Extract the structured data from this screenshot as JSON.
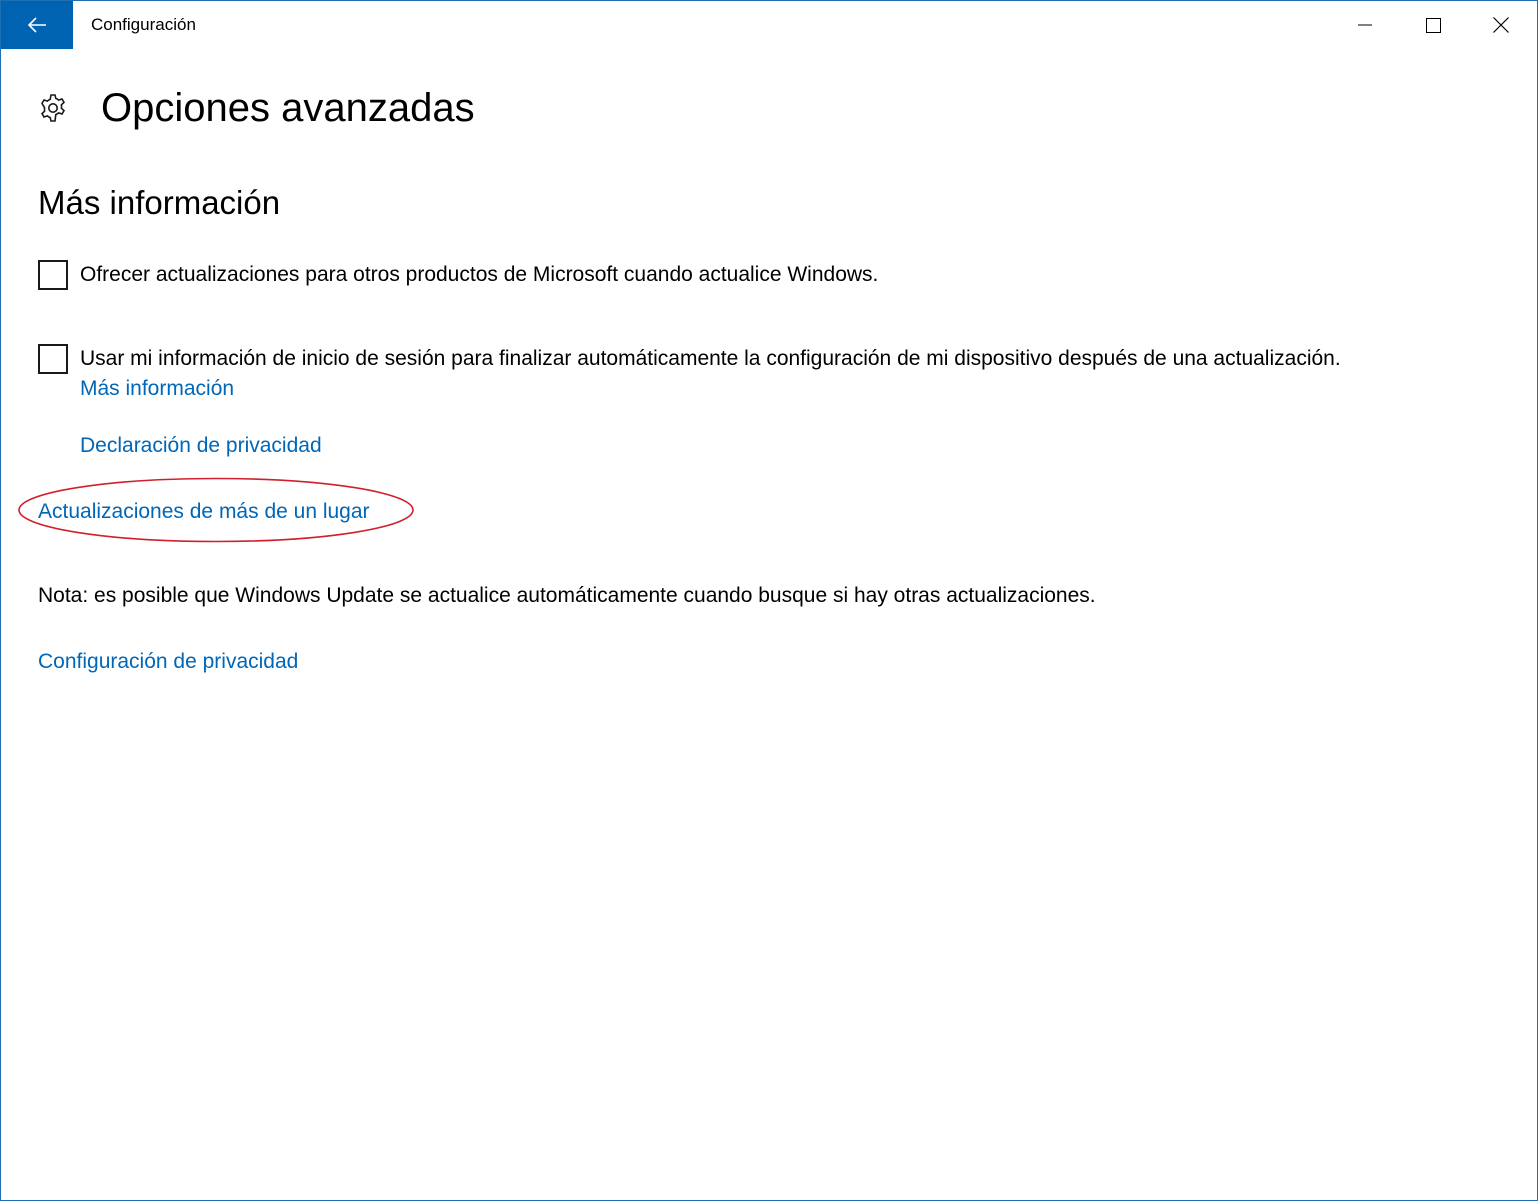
{
  "window": {
    "title": "Configuración",
    "accent_color": "#0063b1",
    "controls": [
      "minimize-icon",
      "maximize-icon",
      "close-icon"
    ]
  },
  "header": {
    "icon": "gear-icon",
    "title": "Opciones avanzadas"
  },
  "section": {
    "title": "Más información"
  },
  "options": [
    {
      "label": "Ofrecer actualizaciones para otros productos de Microsoft cuando actualice Windows.",
      "checked": false
    },
    {
      "label": "Usar mi información de inicio de sesión para finalizar automáticamente la configuración de mi dispositivo después de una actualización.",
      "checked": false
    }
  ],
  "links": {
    "more_info": "Más información",
    "privacy_statement": "Declaración de privacidad",
    "delivery_optimization": "Actualizaciones de más de un lugar",
    "privacy_settings": "Configuración de privacidad"
  },
  "note": "Nota: es posible que Windows Update se actualice automáticamente cuando busque si hay otras actualizaciones.",
  "colors": {
    "link": "#0067b8",
    "highlight": "#d0202e",
    "border": "#1f6fb3"
  }
}
